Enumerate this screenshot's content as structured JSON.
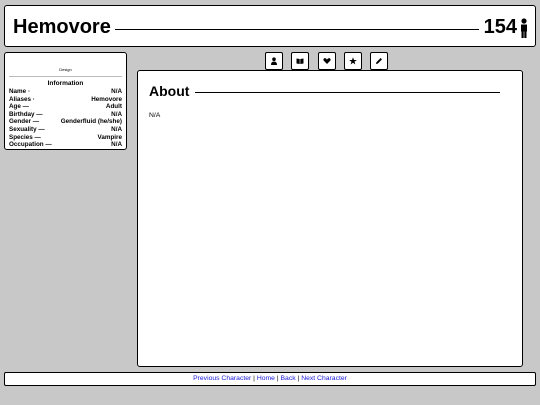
{
  "header": {
    "title": "Hemovore",
    "number": "154"
  },
  "sidebar": {
    "design_label": "Design",
    "info_title": "Information",
    "rows": [
      {
        "label": "Name",
        "value": "N/A"
      },
      {
        "label": "Aliases",
        "value": "Hemovore"
      },
      {
        "label": "Age",
        "value": "Adult"
      },
      {
        "label": "Birthday",
        "value": "N/A"
      },
      {
        "label": "Gender",
        "value": "Genderfluid (he/she)"
      },
      {
        "label": "Sexuality",
        "value": "N/A"
      },
      {
        "label": "Species",
        "value": "Vampire"
      },
      {
        "label": "Occupation",
        "value": "N/A"
      }
    ]
  },
  "tabs": [
    {
      "icon": "person-icon"
    },
    {
      "icon": "book-icon"
    },
    {
      "icon": "heart-icon"
    },
    {
      "icon": "star-icon"
    },
    {
      "icon": "pencil-icon"
    }
  ],
  "main": {
    "title": "About",
    "text": "N/A"
  },
  "footer": {
    "prev": "Previous Character",
    "home": "Home",
    "back": "Back",
    "next": "Next Character",
    "separator": "|"
  }
}
